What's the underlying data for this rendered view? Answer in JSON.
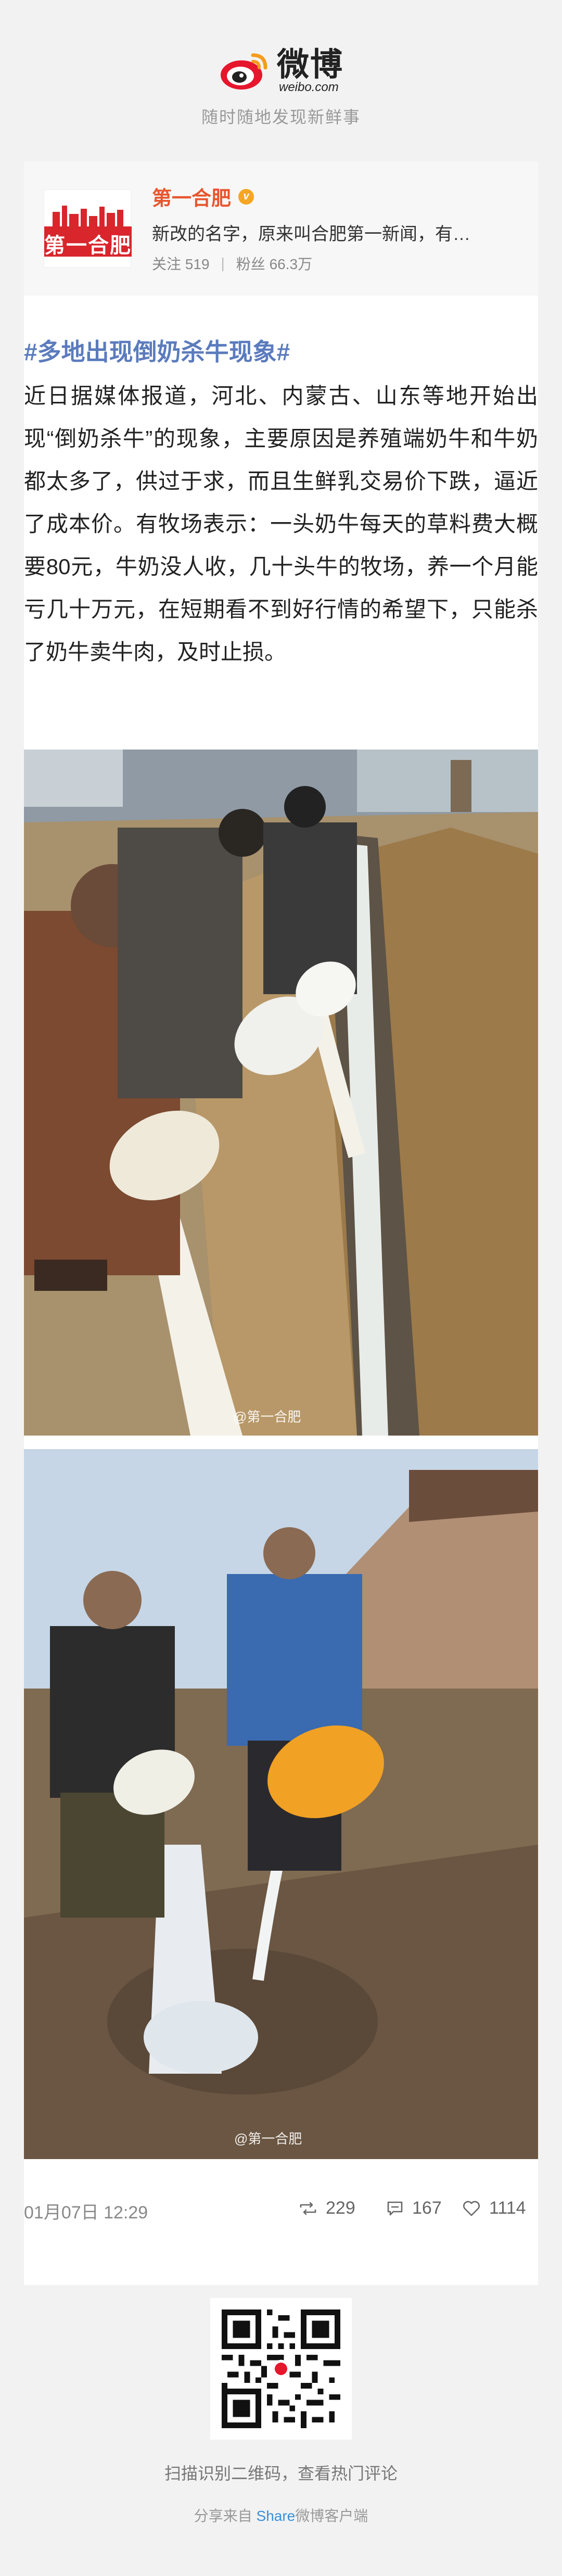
{
  "header": {
    "logo_cn": "微博",
    "logo_en": "weibo.com",
    "slogan": "随时随地发现新鲜事"
  },
  "author": {
    "name": "第一合肥",
    "avatar_text": "第一合肥",
    "verified_icon": "verified-badge-icon",
    "description": "新改的名字，原来叫合肥第一新闻，有…",
    "follow_label": "关注",
    "follow_count": "519",
    "fans_label": "粉丝",
    "fans_count": "66.3万"
  },
  "post": {
    "topic": "#多地出现倒奶杀牛现象#",
    "body": "近日据媒体报道，河北、内蒙古、山东等地开始出现“倒奶杀牛”的现象，主要原因是养殖端奶牛和牛奶都太多了，供过于求，而且生鲜乳交易价下跌，逼近了成本价。有牧场表示：一头奶牛每天的草料费大概要80元，牛奶没人收，几十头牛的牧场，养一个月能亏几十万元，在短期看不到好行情的希望下，只能杀了奶牛卖牛肉，及时止损。",
    "image_watermark_1": "@第一合肥",
    "image_watermark_2": "@第一合肥",
    "date": "01月07日 12:29",
    "reposts": "229",
    "comments": "167",
    "likes": "1114"
  },
  "footer": {
    "qr_caption": "扫描识别二维码，查看热门评论",
    "share_prefix": "分享来自",
    "share_brand": "Share",
    "share_suffix": "微博客户端"
  },
  "colors": {
    "accent_link": "#5b7bbd",
    "author_name": "#e8552d",
    "brand_red": "#d8262c",
    "background": "#f2f2f2"
  }
}
